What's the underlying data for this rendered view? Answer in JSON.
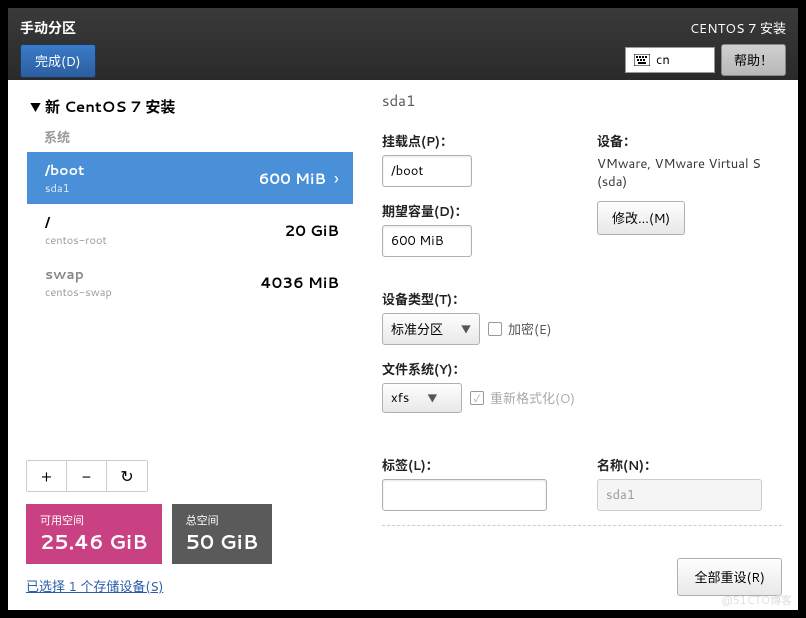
{
  "topbar": {
    "title": "手动分区",
    "done": "完成(D)",
    "installer": "CENTOS 7 安装",
    "keyboard": "cn",
    "help": "帮助！"
  },
  "left": {
    "install_header": "新 CentOS 7 安装",
    "section": "系统",
    "partitions": [
      {
        "mount": "/boot",
        "dev": "sda1",
        "size": "600 MiB",
        "selected": true
      },
      {
        "mount": "/",
        "dev": "centos-root",
        "size": "20 GiB",
        "selected": false
      },
      {
        "mount": "swap",
        "dev": "centos-swap",
        "size": "4036 MiB",
        "selected": false
      }
    ],
    "toolbar": {
      "add": "+",
      "remove": "−",
      "refresh": "↻"
    },
    "avail_label": "可用空间",
    "avail_value": "25.46 GiB",
    "total_label": "总空间",
    "total_value": "50 GiB",
    "storage_link": "已选择 1 个存储设备(S)"
  },
  "right": {
    "title": "sda1",
    "mountpoint_label": "挂载点(P)：",
    "mountpoint_value": "/boot",
    "capacity_label": "期望容量(D)：",
    "capacity_value": "600 MiB",
    "device_label": "设备：",
    "device_text": "VMware, VMware Virtual S (sda)",
    "modify": "修改...(M)",
    "devtype_label": "设备类型(T)：",
    "devtype_value": "标准分区",
    "encrypt_label": "加密(E)",
    "fs_label": "文件系统(Y)：",
    "fs_value": "xfs",
    "reformat_label": "重新格式化(O)",
    "label_label": "标签(L)：",
    "label_value": "",
    "name_label": "名称(N)：",
    "name_value": "sda1",
    "reset": "全部重设(R)"
  },
  "watermark": "@51CTO博客"
}
